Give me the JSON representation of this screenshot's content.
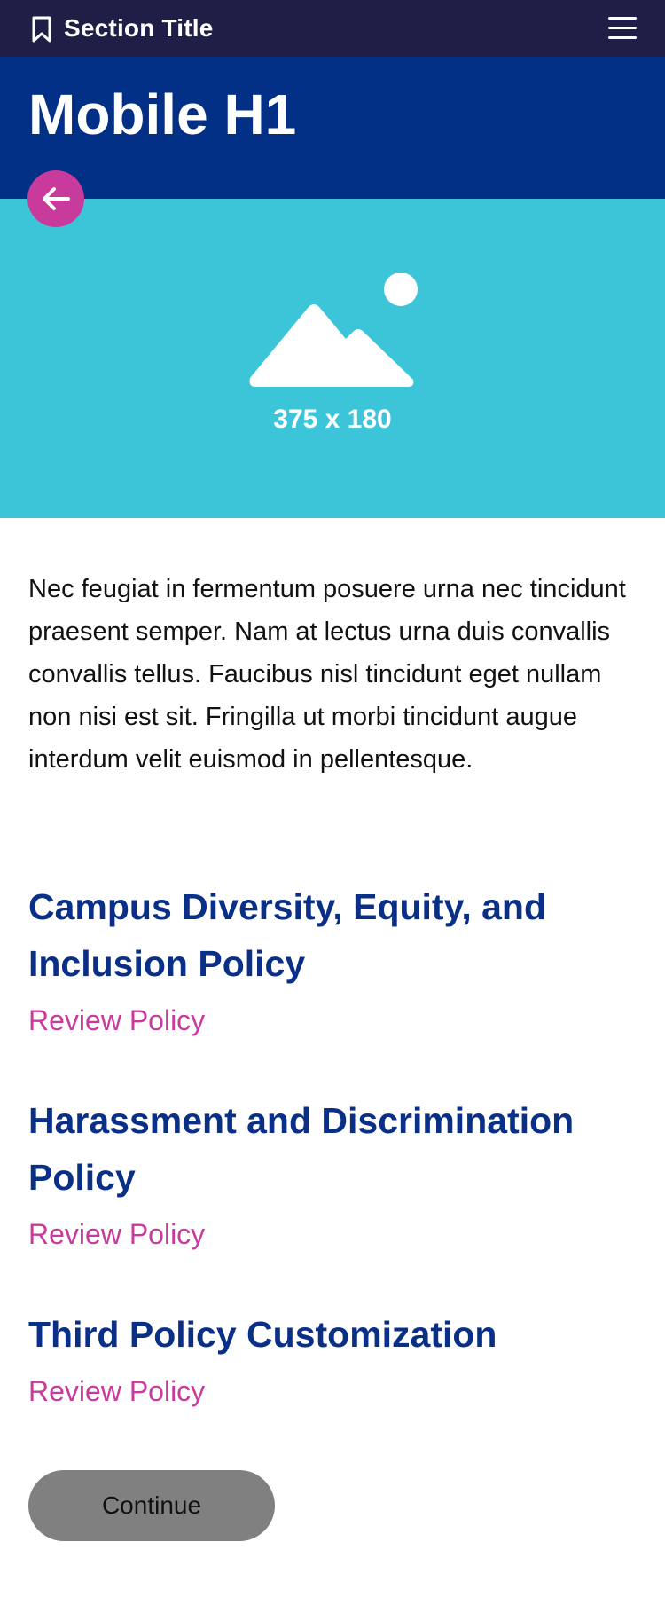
{
  "header": {
    "section_title": "Section Title",
    "bookmark_icon": "bookmark-icon",
    "menu_icon": "hamburger-menu-icon"
  },
  "page": {
    "title": "Mobile H1",
    "back_icon": "arrow-left-icon"
  },
  "hero_image": {
    "icon": "image-placeholder-icon",
    "size_label": "375 x 180"
  },
  "intro_text": "Nec feugiat in fermentum posuere urna nec tincidunt praesent semper. Nam at lectus urna duis convallis convallis tellus. Faucibus nisl tincidunt eget nullam non nisi est sit. Fringilla ut morbi tincidunt augue interdum velit euismod in pellentesque.",
  "policies": [
    {
      "title": "Campus Diversity, Equity, and Inclusion Policy",
      "link": "Review Policy"
    },
    {
      "title": "Harassment and Discrimination Policy",
      "link": "Review Policy"
    },
    {
      "title": "Third Policy Customization",
      "link": "Review Policy"
    }
  ],
  "footer": {
    "continue_label": "Continue"
  },
  "colors": {
    "topbar": "#1f1e47",
    "header_blue": "#023087",
    "image_cyan": "#3cc5d9",
    "accent_magenta": "#c93a9d",
    "heading_blue": "#0a2f86",
    "button_gray": "#808080"
  }
}
